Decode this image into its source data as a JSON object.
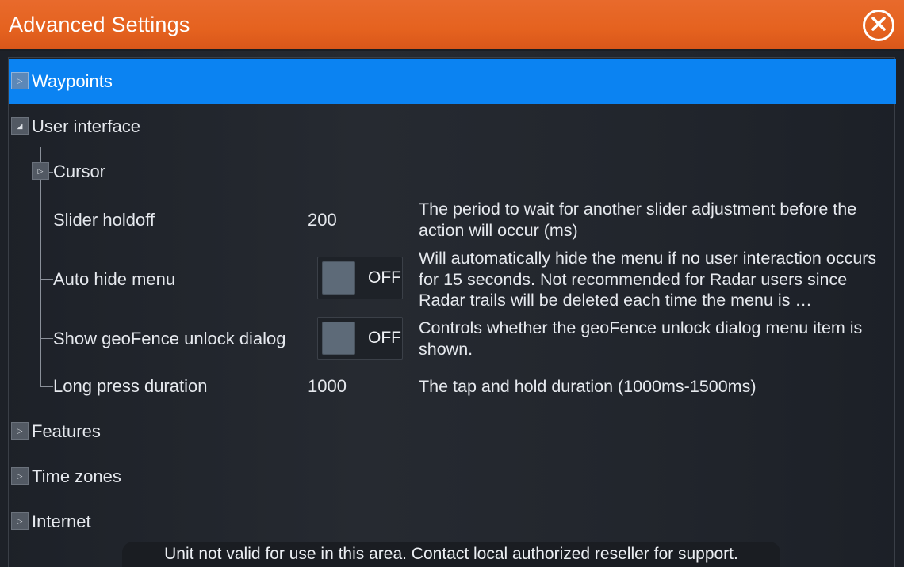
{
  "window": {
    "title": "Advanced Settings",
    "close_icon": "close-icon"
  },
  "tree": {
    "waypoints": {
      "label": "Waypoints",
      "expanded": false,
      "selected": true
    },
    "user_interface": {
      "label": "User interface",
      "expanded": true
    },
    "cursor": {
      "label": "Cursor",
      "expanded": false
    },
    "settings": [
      {
        "label": "Slider holdoff",
        "value": "200",
        "description": "The period to wait for another slider adjustment before the action will occur (ms)"
      },
      {
        "label": "Auto hide menu",
        "toggle": "OFF",
        "description": "Will automatically hide the menu if no user interaction occurs for 15 seconds.  Not recommended for Radar users since Radar trails will be deleted each time the menu is …"
      },
      {
        "label": "Show geoFence unlock dialog",
        "toggle": "OFF",
        "description": "Controls whether the geoFence unlock dialog menu item is shown."
      },
      {
        "label": "Long press duration",
        "value": "1000",
        "description": "The tap and hold duration (1000ms-1500ms)"
      }
    ],
    "features": {
      "label": "Features",
      "expanded": false
    },
    "time_zones": {
      "label": "Time zones",
      "expanded": false
    },
    "internet": {
      "label": "Internet",
      "expanded": false
    }
  },
  "status": {
    "message": "Unit not valid for use in this area.  Contact local authorized reseller for support."
  },
  "colors": {
    "titlebar": "#e5621f",
    "selection": "#0b83f2",
    "background": "#22262d"
  }
}
